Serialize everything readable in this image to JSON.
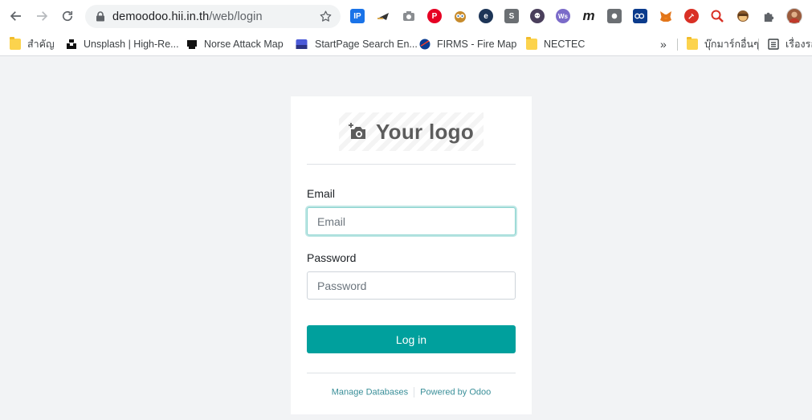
{
  "browser": {
    "url_host": "demoodoo.hii.in.th",
    "url_path": "/web/login"
  },
  "bookmarks": [
    {
      "label": "สำคัญ",
      "icon": "folder-icon"
    },
    {
      "label": "Unsplash | High-Re...",
      "icon": "unsplash-icon"
    },
    {
      "label": "Norse Attack Map",
      "icon": "norse-icon"
    },
    {
      "label": "StartPage Search En...",
      "icon": "startpage-icon"
    },
    {
      "label": "FIRMS - Fire Map",
      "icon": "nasa-icon"
    },
    {
      "label": "NECTEC",
      "icon": "folder-icon"
    },
    {
      "label": "»",
      "icon": ""
    },
    {
      "label": "บุ๊กมาร์กอื่นๆ",
      "icon": "folder-icon"
    },
    {
      "label": "เรื่องรอ",
      "icon": "reading-list-icon"
    }
  ],
  "extensions": {
    "ip_label": "IP",
    "m_label": "m",
    "ws_label": "Ws"
  },
  "login": {
    "logo_text": "Your logo",
    "email_label": "Email",
    "email_placeholder": "Email",
    "password_label": "Password",
    "password_placeholder": "Password",
    "login_button": "Log in",
    "manage_databases": "Manage Databases",
    "powered_by": "Powered by Odoo"
  },
  "colors": {
    "primary": "#00a09d",
    "focus_border": "#8ad3cf",
    "link": "#3a8f99",
    "page_bg": "#f2f3f5"
  }
}
